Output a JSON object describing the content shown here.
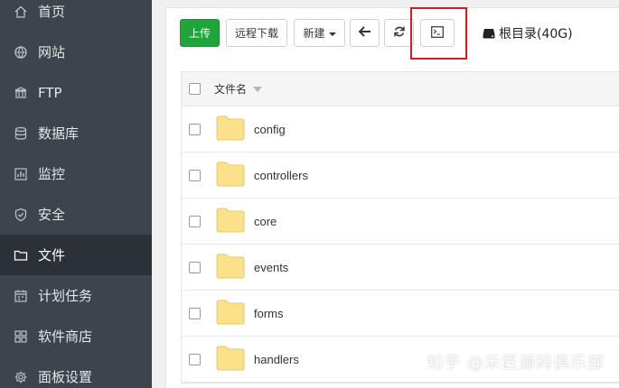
{
  "sidebar": {
    "items": [
      {
        "label": "首页",
        "icon": "home-icon"
      },
      {
        "label": "网站",
        "icon": "globe-icon"
      },
      {
        "label": "FTP",
        "icon": "ftp-icon"
      },
      {
        "label": "数据库",
        "icon": "database-icon"
      },
      {
        "label": "监控",
        "icon": "monitor-icon"
      },
      {
        "label": "安全",
        "icon": "shield-icon"
      },
      {
        "label": "文件",
        "icon": "folder-icon",
        "active": true
      },
      {
        "label": "计划任务",
        "icon": "calendar-icon"
      },
      {
        "label": "软件商店",
        "icon": "apps-icon"
      },
      {
        "label": "面板设置",
        "icon": "gear-icon"
      }
    ]
  },
  "toolbar": {
    "upload_label": "上传",
    "remote_download_label": "远程下载",
    "new_label": "新建",
    "back_icon": "arrow-left-icon",
    "refresh_icon": "refresh-icon",
    "terminal_icon": "terminal-icon",
    "disk_label": "根目录(40G)"
  },
  "table": {
    "header_label": "文件名",
    "rows": [
      "config",
      "controllers",
      "core",
      "events",
      "forms",
      "handlers"
    ]
  },
  "colors": {
    "sidebar_bg": "#3c444d",
    "sidebar_active_bg": "#2c3138",
    "primary_green": "#20a53a",
    "highlight_red": "#cc1f1f",
    "folder_yellow": "#fbe18a"
  },
  "watermark": "知乎 @禾匠源码俱乐部"
}
